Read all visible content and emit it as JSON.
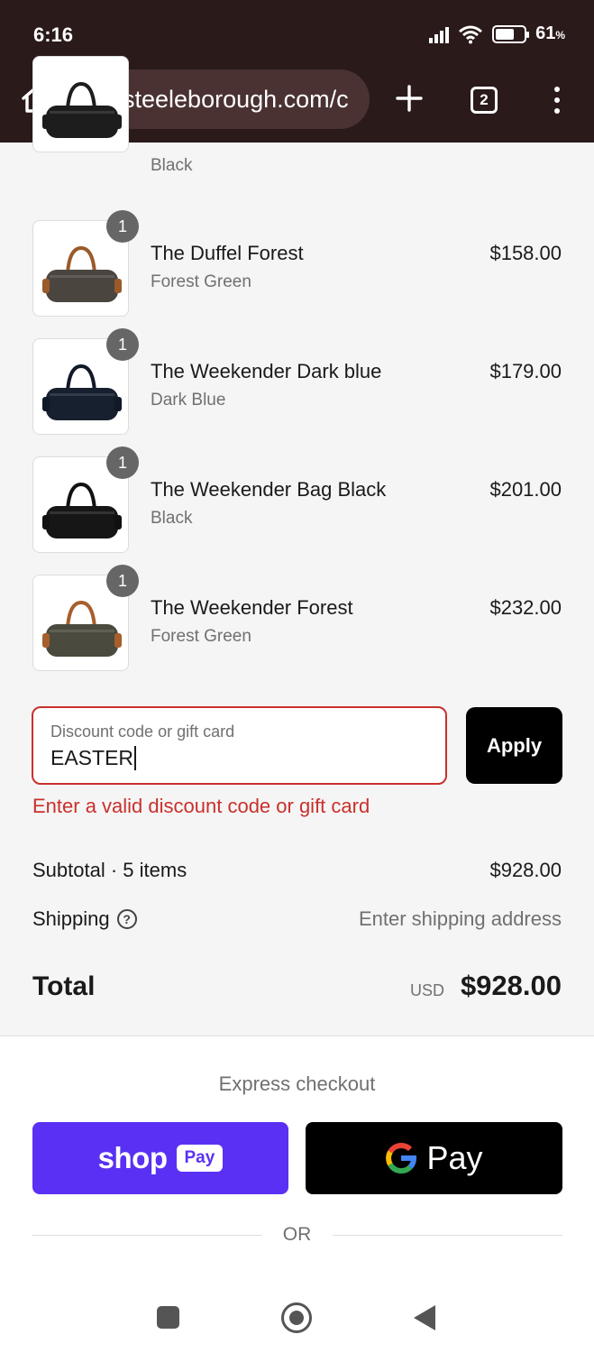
{
  "status_bar": {
    "time": "6:16",
    "battery_percent": "61",
    "battery_unit": "%"
  },
  "browser": {
    "url": "steeleborough.com/c",
    "tab_count": "2"
  },
  "cart": {
    "items": [
      {
        "name": "",
        "variant": "Black",
        "price": "",
        "quantity": "",
        "bag_color": "#1d1d1d",
        "handle_color": "#1d1d1d"
      },
      {
        "name": "The Duffel Forest",
        "variant": "Forest Green",
        "price": "$158.00",
        "quantity": "1",
        "bag_color": "#4b4540",
        "handle_color": "#9a5a2a"
      },
      {
        "name": "The Weekender Dark blue",
        "variant": "Dark Blue",
        "price": "$179.00",
        "quantity": "1",
        "bag_color": "#16202e",
        "handle_color": "#111827"
      },
      {
        "name": "The Weekender Bag Black",
        "variant": "Black",
        "price": "$201.00",
        "quantity": "1",
        "bag_color": "#161616",
        "handle_color": "#111111"
      },
      {
        "name": "The Weekender Forest",
        "variant": "Forest Green",
        "price": "$232.00",
        "quantity": "1",
        "bag_color": "#4a4a3e",
        "handle_color": "#a65f2c"
      }
    ]
  },
  "discount": {
    "placeholder": "Discount code or gift card",
    "value": "EASTER",
    "apply_label": "Apply",
    "error": "Enter a valid discount code or gift card"
  },
  "summary": {
    "subtotal_label": "Subtotal · 5 items",
    "subtotal_value": "$928.00",
    "shipping_label": "Shipping",
    "shipping_value": "Enter shipping address",
    "total_label": "Total",
    "currency": "USD",
    "total_value": "$928.00"
  },
  "express": {
    "title": "Express checkout",
    "shop_label": "shop",
    "shop_badge": "Pay",
    "gpay_label": "Pay",
    "or_text": "OR"
  },
  "colors": {
    "error": "#c9302c",
    "shop_pay": "#5a31f4",
    "browser_bar": "#2b1a1a"
  },
  "icons": [
    "home-icon",
    "tune-icon",
    "plus-icon",
    "tabs-icon",
    "more-vert-icon",
    "help-icon",
    "google-g-icon"
  ]
}
